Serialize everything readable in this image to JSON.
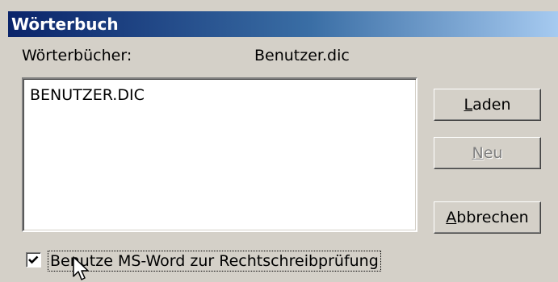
{
  "window": {
    "title": "Wörterbuch"
  },
  "dictionaries": {
    "label": "Wörterbücher:",
    "current": "Benutzer.dic",
    "items": [
      "BENUTZER.DIC"
    ]
  },
  "buttons": {
    "load": {
      "prefix": "",
      "mnemonic": "L",
      "suffix": "aden"
    },
    "new": {
      "prefix": "",
      "mnemonic": "N",
      "suffix": "eu",
      "disabled": true
    },
    "cancel": {
      "prefix": "",
      "mnemonic": "A",
      "suffix": "bbrechen"
    }
  },
  "checkbox": {
    "label": "Benutze MS-Word zur Rechtschreibprüfung",
    "checked": true
  },
  "colors": {
    "title_start": "#0a246a",
    "title_end": "#a6caf0",
    "face": "#d4d0c8"
  },
  "icons": {
    "checkmark": "check-icon",
    "pointer": "mouse-pointer-icon"
  }
}
